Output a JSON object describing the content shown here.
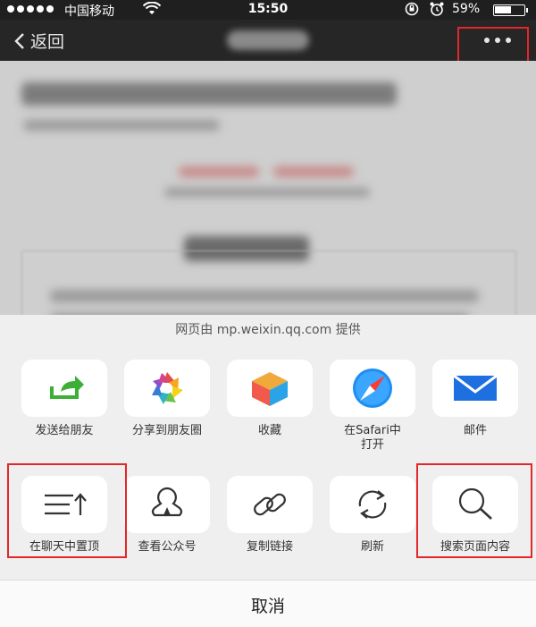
{
  "status_bar": {
    "carrier": "中国移动",
    "time": "15:50",
    "battery_percent": "59%",
    "battery_level": 0.59
  },
  "nav": {
    "back_label": "返回"
  },
  "share_sheet": {
    "provider_text": "网页由 mp.weixin.qq.com 提供",
    "row1": [
      {
        "label": "发送给朋友",
        "icon": "send-to-friend-icon"
      },
      {
        "label": "分享到朋友圈",
        "icon": "moments-icon"
      },
      {
        "label": "收藏",
        "icon": "favorite-cube-icon"
      },
      {
        "label": "在Safari中\n打开",
        "icon": "safari-icon"
      },
      {
        "label": "邮件",
        "icon": "mail-icon"
      }
    ],
    "row2": [
      {
        "label": "在聊天中置顶",
        "icon": "pin-to-top-icon"
      },
      {
        "label": "查看公众号",
        "icon": "official-account-icon"
      },
      {
        "label": "复制链接",
        "icon": "link-icon"
      },
      {
        "label": "刷新",
        "icon": "refresh-icon"
      },
      {
        "label": "搜索页面内容",
        "icon": "search-icon"
      }
    ],
    "cancel_label": "取消"
  },
  "colors": {
    "highlight": "#e3262a",
    "accent_green": "#3cb034",
    "mail_blue": "#1e6fe0"
  }
}
